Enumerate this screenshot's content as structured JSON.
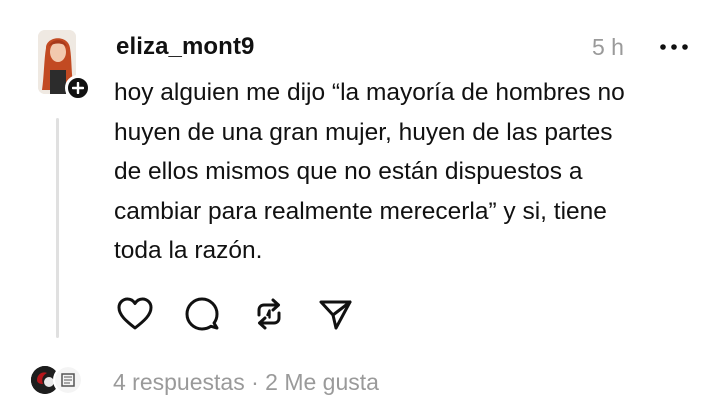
{
  "post": {
    "username": "eliza_mont9",
    "time": "5 h",
    "text": "hoy alguien me dijo “la mayoría de hombres no\nhuyen de una gran mujer, huyen de las partes\nde ellos mismos que no están dispuestos a\ncambiar para realmente merecerla” y si, tiene\ntoda la razón.",
    "avatar_icon": "profile-photo",
    "more_icon": "ellipsis-icon"
  },
  "actions": {
    "like_icon": "heart-icon",
    "reply_icon": "comment-icon",
    "repost_icon": "repost-icon",
    "share_icon": "send-icon"
  },
  "footer": {
    "replies": "4 respuestas",
    "separator": "·",
    "likes": "2 Me gusta"
  },
  "colors": {
    "text": "#111111",
    "secondary": "#9a9a9a",
    "thread_line": "#e0e0e0"
  }
}
